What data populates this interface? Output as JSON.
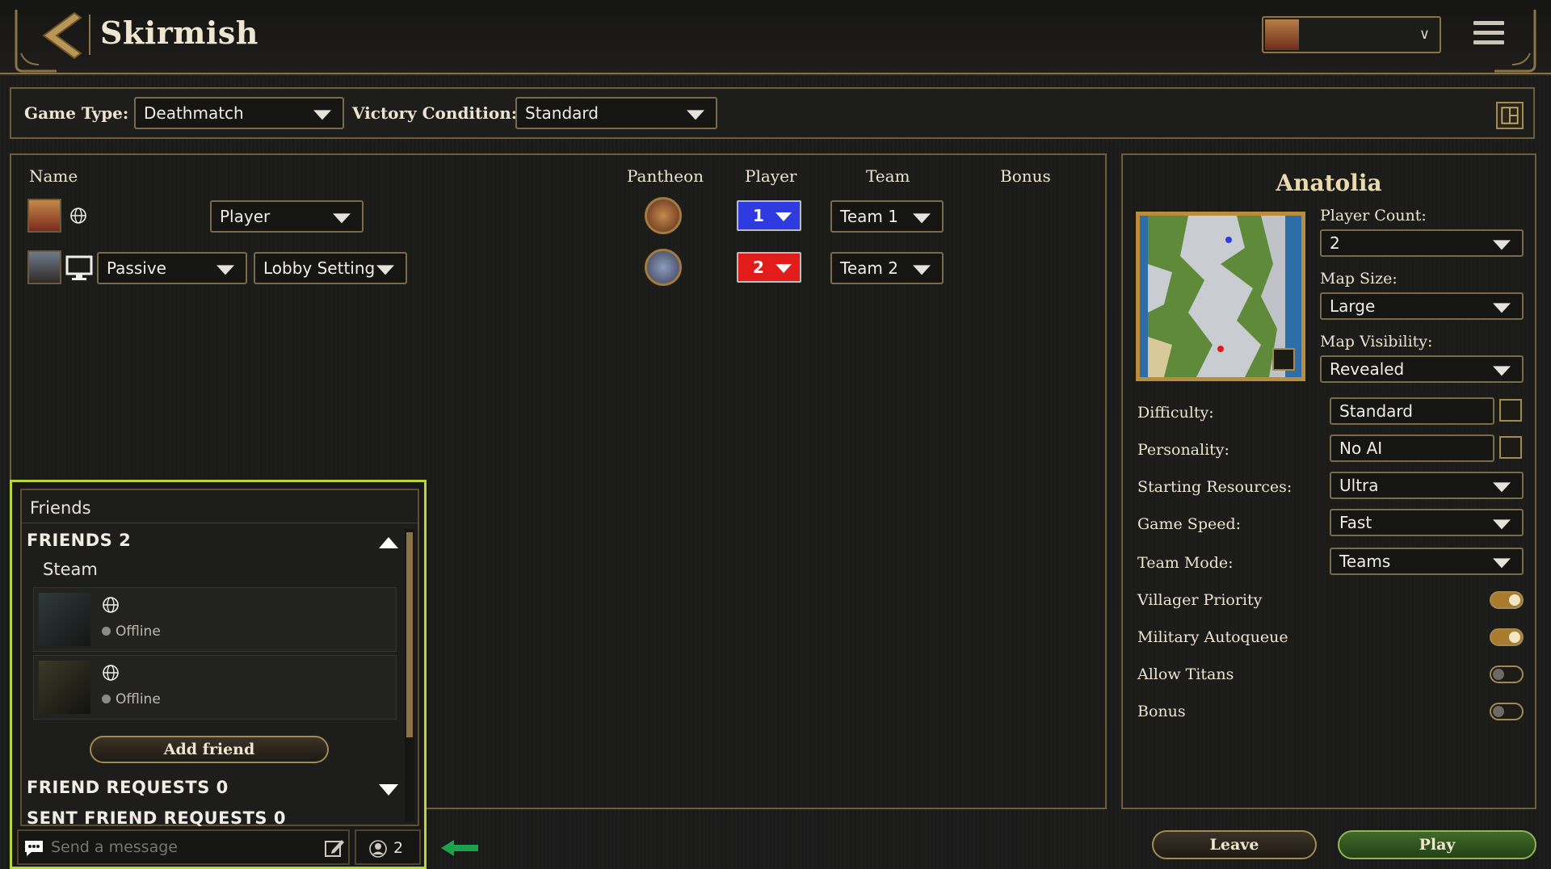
{
  "header": {
    "title": "Skirmish",
    "profile_icon": "player-portrait",
    "menu_icon": "hamburger-icon"
  },
  "settings": {
    "game_type_label": "Game Type:",
    "game_type_value": "Deathmatch",
    "victory_label": "Victory Condition:",
    "victory_value": "Standard"
  },
  "players_table": {
    "columns": [
      "Name",
      "Pantheon",
      "Player",
      "Team",
      "Bonus"
    ],
    "rows": [
      {
        "type_value": "Player",
        "player_number": "1",
        "player_color": "#2e3be0",
        "team": "Team 1"
      },
      {
        "ai_value": "Passive",
        "type_value": "Lobby Setting",
        "player_number": "2",
        "player_color": "#e21b1b",
        "team": "Team 2"
      }
    ]
  },
  "map": {
    "name": "Anatolia",
    "player_count_label": "Player Count:",
    "player_count_value": "2",
    "map_size_label": "Map Size:",
    "map_size_value": "Large",
    "map_visibility_label": "Map Visibility:",
    "map_visibility_value": "Revealed",
    "difficulty_label": "Difficulty:",
    "difficulty_value": "Standard",
    "personality_label": "Personality:",
    "personality_value": "No AI",
    "starting_resources_label": "Starting Resources:",
    "starting_resources_value": "Ultra",
    "game_speed_label": "Game Speed:",
    "game_speed_value": "Fast",
    "team_mode_label": "Team Mode:",
    "team_mode_value": "Teams",
    "toggles": [
      {
        "label": "Villager Priority",
        "on": true
      },
      {
        "label": "Military Autoqueue",
        "on": true
      },
      {
        "label": "Allow Titans",
        "on": false
      },
      {
        "label": "Bonus",
        "on": false
      }
    ]
  },
  "friends": {
    "title": "Friends",
    "section_friends": "FRIENDS 2",
    "platform": "Steam",
    "entries": [
      {
        "status": "Offline"
      },
      {
        "status": "Offline"
      }
    ],
    "add_friend_label": "Add friend",
    "section_requests": "FRIEND REQUESTS 0",
    "section_sent": "SENT FRIEND REQUESTS 0",
    "message_placeholder": "Send a message",
    "online_count": "2"
  },
  "actions": {
    "leave_label": "Leave",
    "play_label": "Play"
  },
  "colors": {
    "accent_gold": "#8a7446",
    "highlight_green": "#b8d53a",
    "play_green": "#2f5a1e"
  }
}
